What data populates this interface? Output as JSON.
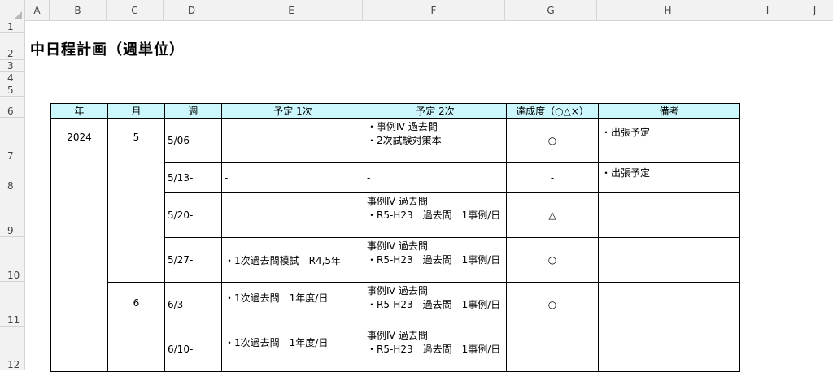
{
  "columns": [
    "A",
    "B",
    "C",
    "D",
    "E",
    "F",
    "G",
    "H",
    "I",
    "J"
  ],
  "rows": [
    "1",
    "2",
    "3",
    "4",
    "5",
    "6",
    "7",
    "8",
    "9",
    "10",
    "11",
    "12"
  ],
  "title": "中日程計画（週単位）",
  "headers": {
    "year": "年",
    "month": "月",
    "week": "週",
    "plan1": "予定 1次",
    "plan2": "予定 2次",
    "achievement": "達成度（○△×）",
    "notes": "備考"
  },
  "year": "2024",
  "months": [
    "5",
    "6"
  ],
  "weeks": [
    {
      "week": "5/06-",
      "plan1": "-",
      "plan2": [
        "・事例Ⅳ 過去問",
        "・2次試験対策本"
      ],
      "achievement": "○",
      "notes": "・出張予定"
    },
    {
      "week": "5/13-",
      "plan1": "-",
      "plan2": [
        "-"
      ],
      "achievement": "-",
      "notes": "・出張予定"
    },
    {
      "week": "5/20-",
      "plan1": "",
      "plan2": [
        "事例Ⅳ 過去問",
        "・R5-H23　過去問　1事例/日"
      ],
      "achievement": "△",
      "notes": ""
    },
    {
      "week": "5/27-",
      "plan1": "・1次過去問模試　R4,5年",
      "plan2": [
        "事例Ⅳ 過去問",
        "・R5-H23　過去問　1事例/日"
      ],
      "achievement": "○",
      "notes": ""
    },
    {
      "week": "6/3-",
      "plan1": "・1次過去問　1年度/日",
      "plan2": [
        "事例Ⅳ 過去問",
        "・R5-H23　過去問　1事例/日"
      ],
      "achievement": "○",
      "notes": ""
    },
    {
      "week": "6/10-",
      "plan1": "・1次過去問　1年度/日",
      "plan2": [
        "事例Ⅳ 過去問",
        "・R5-H23　過去問　1事例/日"
      ],
      "achievement": "",
      "notes": ""
    }
  ]
}
